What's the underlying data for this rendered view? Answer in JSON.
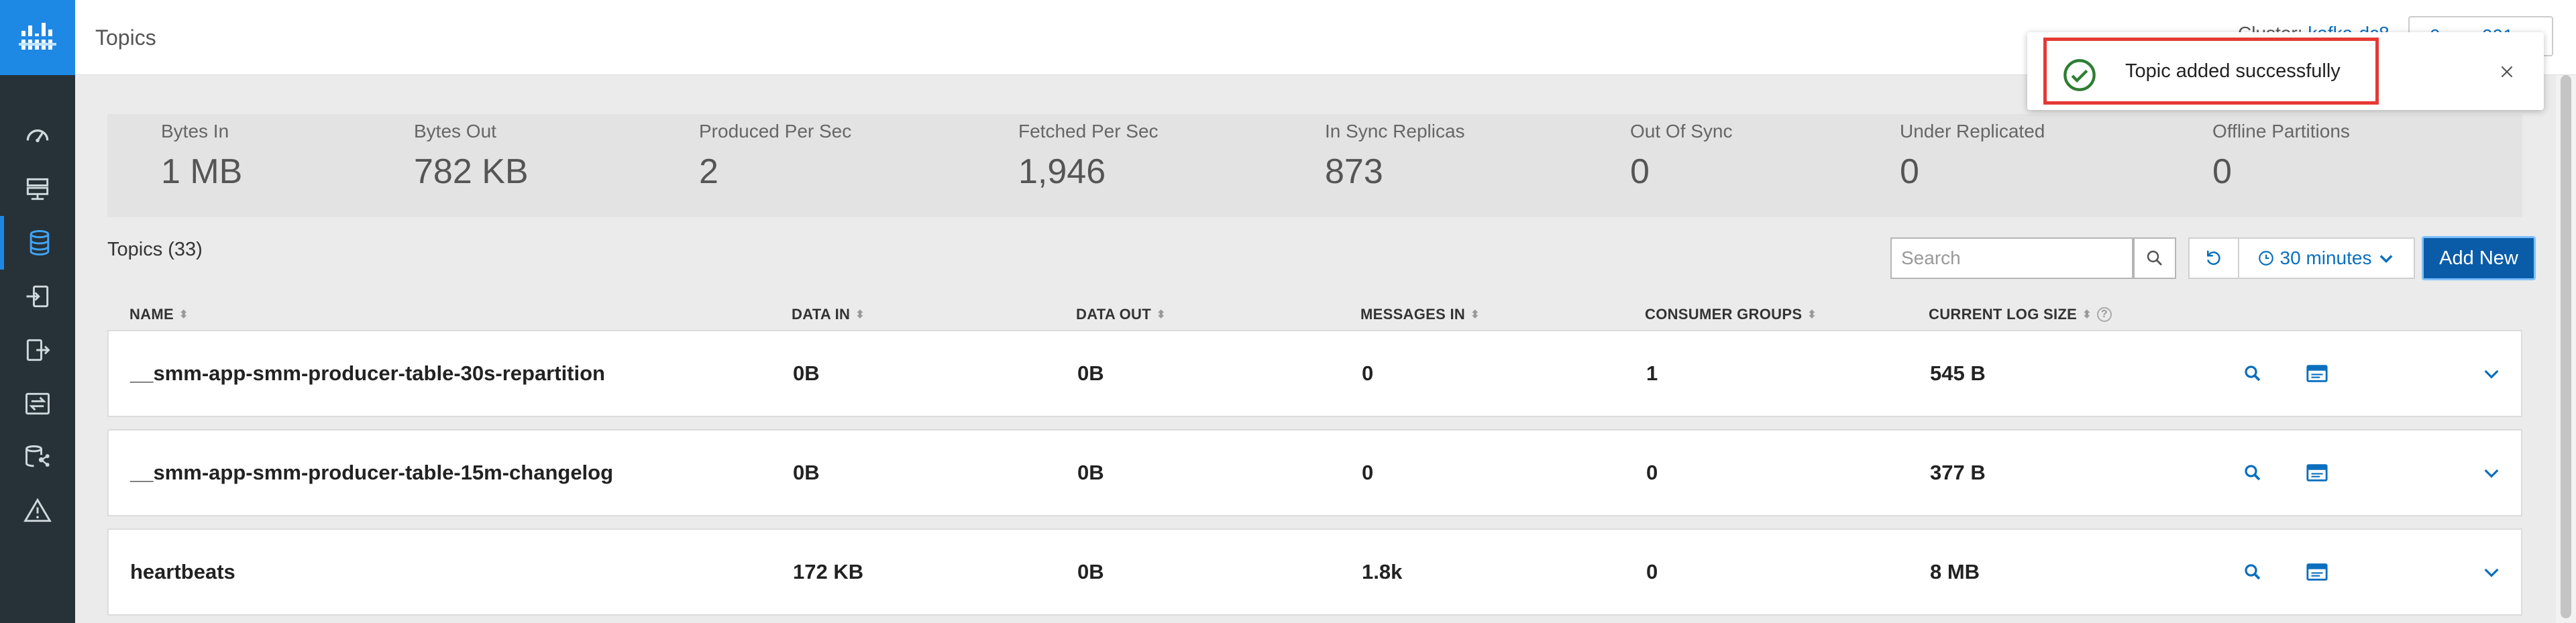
{
  "header": {
    "title": "Topics",
    "cluster_label": "Cluster: ",
    "cluster_value": "kafka-dc8",
    "user_label": "0 user001"
  },
  "metrics": [
    {
      "label": "Bytes In",
      "value": "1 MB"
    },
    {
      "label": "Bytes Out",
      "value": "782 KB"
    },
    {
      "label": "Produced Per Sec",
      "value": "2"
    },
    {
      "label": "Fetched Per Sec",
      "value": "1,946"
    },
    {
      "label": "In Sync Replicas",
      "value": "873"
    },
    {
      "label": "Out Of Sync",
      "value": "0"
    },
    {
      "label": "Under Replicated",
      "value": "0"
    },
    {
      "label": "Offline Partitions",
      "value": "0"
    }
  ],
  "toolbar": {
    "topics_count": "Topics (33)",
    "search_placeholder": "Search",
    "time_range": "30 minutes",
    "add_new": "Add New"
  },
  "table": {
    "columns": [
      "NAME",
      "DATA IN",
      "DATA OUT",
      "MESSAGES IN",
      "CONSUMER GROUPS",
      "CURRENT LOG SIZE"
    ],
    "rows": [
      {
        "name": "__smm-app-smm-producer-table-30s-repartition",
        "data_in": "0B",
        "data_out": "0B",
        "messages_in": "0",
        "consumer_groups": "1",
        "log_size": "545 B"
      },
      {
        "name": "__smm-app-smm-producer-table-15m-changelog",
        "data_in": "0B",
        "data_out": "0B",
        "messages_in": "0",
        "consumer_groups": "0",
        "log_size": "377 B"
      },
      {
        "name": "heartbeats",
        "data_in": "172 KB",
        "data_out": "0B",
        "messages_in": "1.8k",
        "consumer_groups": "0",
        "log_size": "8 MB"
      }
    ]
  },
  "toast": {
    "message": "Topic added successfully"
  },
  "colors": {
    "accent": "#1e88e5",
    "primary_button": "#0a5ca8",
    "sidebar": "#263238",
    "success": "#2e7d32",
    "highlight": "#e53935"
  },
  "icons": {
    "sidebar": [
      "dashboard-icon",
      "brokers-icon",
      "topics-icon",
      "producers-icon",
      "consumers-icon",
      "replication-icon",
      "data-explorer-icon",
      "alerts-icon"
    ]
  }
}
